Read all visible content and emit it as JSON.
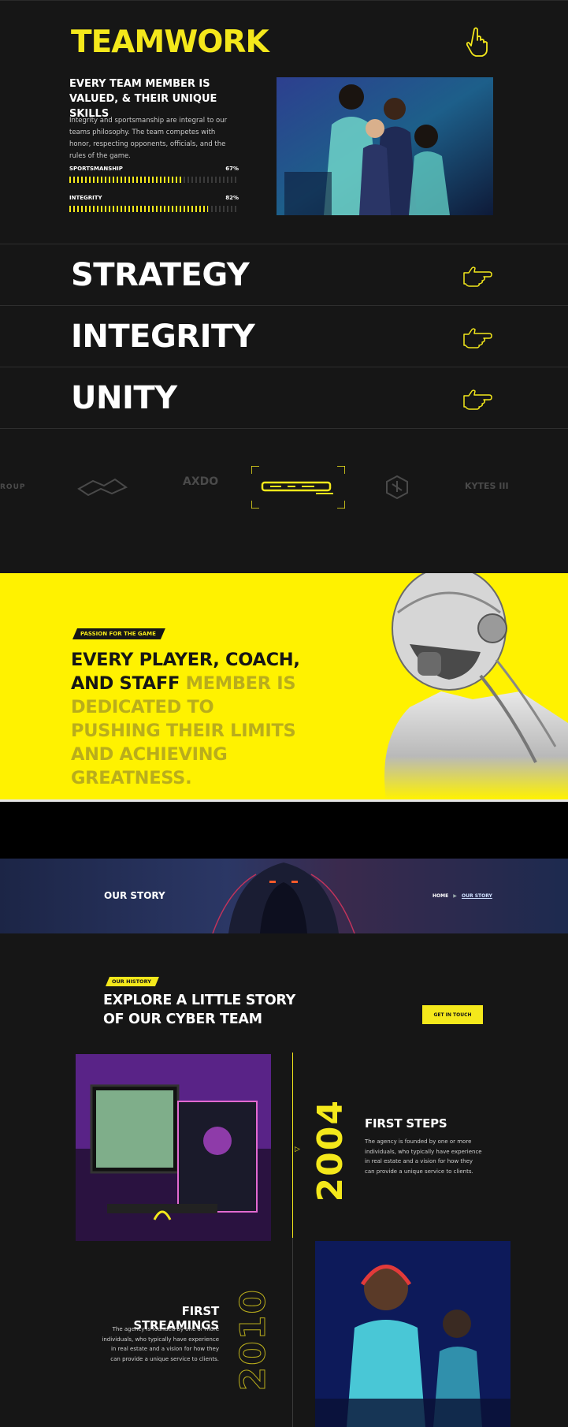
{
  "teamwork": {
    "title": "TEAMWORK",
    "subtitle": "EVERY TEAM MEMBER IS VALUED, & THEIR UNIQUE SKILLS",
    "description": "Integrity and sportsmanship are integral to our teams philosophy. The team competes with honor, respecting opponents, officials, and the rules of the game.",
    "bars": [
      {
        "label": "SPORTSMANSHIP",
        "percent_text": "67%",
        "value": 0.67
      },
      {
        "label": "INTEGRITY",
        "percent_text": "82%",
        "value": 0.82
      }
    ],
    "pointer_icon": "hand-pointer-up-icon"
  },
  "values": [
    {
      "label": "STRATEGY",
      "icon": "hand-pointing-right-icon"
    },
    {
      "label": "INTEGRITY",
      "icon": "hand-pointing-right-icon"
    },
    {
      "label": "UNITY",
      "icon": "hand-pointing-right-icon"
    }
  ],
  "brands": {
    "items": [
      "ROUP",
      "AXDO",
      "KYTES III"
    ],
    "active_index": 3
  },
  "passion": {
    "tag": "PASSION FOR THE GAME",
    "headline_dark": "EVERY PLAYER, COACH, AND STAFF",
    "headline_faded": "MEMBER IS DEDICATED TO PUSHING THEIR LIMITS AND ACHIEVING GREATNESS."
  },
  "story_banner": {
    "title": "OUR STORY",
    "breadcrumb_home": "HOME",
    "breadcrumb_separator": "▶",
    "breadcrumb_current": "OUR STORY"
  },
  "history": {
    "tag": "OUR HISTORY",
    "title": "EXPLORE A LITTLE STORY OF OUR CYBER TEAM",
    "button": "GET IN TOUCH",
    "events": [
      {
        "year": "2004",
        "title": "FIRST STEPS",
        "text": "The agency is founded by one or more individuals, who typically have experience in real estate and a vision for how they can provide a unique service to clients."
      },
      {
        "year": "2010",
        "title": "FIRST STREAMINGS",
        "text": "The agency is founded by one or more individuals, who typically have experience in real estate and a vision for how they can provide a unique service to clients."
      }
    ]
  },
  "colors": {
    "accent": "#f4e81b",
    "background": "#161616",
    "hero_yellow": "#fff200"
  }
}
